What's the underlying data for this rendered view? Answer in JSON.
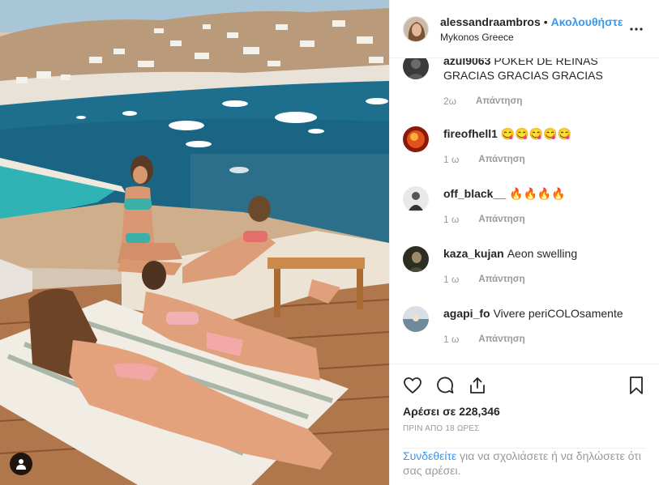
{
  "post": {
    "username": "alessandraambros",
    "separator": "•",
    "follow_label": "Ακολουθήστε",
    "location": "Mykonos Greece"
  },
  "comments": [
    {
      "user": "azul9063",
      "text": "POKER DE REINAS GRACIAS GRACIAS GRACIAS",
      "time": "2ω",
      "reply": "Απάντηση"
    },
    {
      "user": "fireofhell1",
      "text": "😋😋😋😋😋",
      "time": "1 ω",
      "reply": "Απάντηση"
    },
    {
      "user": "off_black__",
      "text": "🔥🔥🔥🔥",
      "time": "1 ω",
      "reply": "Απάντηση"
    },
    {
      "user": "kaza_kujan",
      "text": "Aeon swelling",
      "time": "1 ω",
      "reply": "Απάντηση"
    },
    {
      "user": "agapi_fo",
      "text": "Vivere periCOLOsamente",
      "time": "1 ω",
      "reply": "Απάντηση"
    }
  ],
  "likes": "Αρέσει σε 228,346",
  "posted_ago": "ΠΡΙΝ ΑΠΟ 18 ΩΡΕΣ",
  "login_prompt": {
    "link": "Συνδεθείτε",
    "text": " για να σχολιάσετε ή να δηλώσετε ότι σας αρέσει."
  },
  "icons": {
    "like": "heart-icon",
    "comment": "comment-icon",
    "share": "share-icon",
    "save": "bookmark-icon",
    "more": "more-options-icon",
    "tag": "user-tag-icon"
  }
}
